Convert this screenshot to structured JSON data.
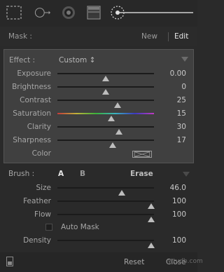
{
  "toolbar": {
    "tools": [
      {
        "name": "crop-overlay-tool",
        "icon": "crop-icon"
      },
      {
        "name": "spot-removal-tool",
        "icon": "spot-circle-arrow-icon"
      },
      {
        "name": "red-eye-tool",
        "icon": "red-eye-icon"
      },
      {
        "name": "graduated-filter-tool",
        "icon": "graduated-filter-icon"
      },
      {
        "name": "adjustment-brush-tool",
        "icon": "adjustment-brush-icon"
      }
    ]
  },
  "mask": {
    "label": "Mask :",
    "new_label": "New",
    "edit_label": "Edit"
  },
  "effect": {
    "label": "Effect :",
    "preset": "Custom ↕",
    "sliders": [
      {
        "label": "Exposure",
        "value": "0.00",
        "position": 0.5
      },
      {
        "label": "Brightness",
        "value": "0",
        "position": 0.5
      },
      {
        "label": "Contrast",
        "value": "25",
        "position": 0.62
      },
      {
        "label": "Saturation",
        "value": "15",
        "position": 0.56
      },
      {
        "label": "Clarity",
        "value": "30",
        "position": 0.64
      },
      {
        "label": "Sharpness",
        "value": "17",
        "position": 0.57
      }
    ],
    "color_label": "Color"
  },
  "brush": {
    "label": "Brush :",
    "a_label": "A",
    "b_label": "B",
    "erase_label": "Erase",
    "sliders": [
      {
        "label": "Size",
        "value": "46.0",
        "position": 0.67
      },
      {
        "label": "Feather",
        "value": "100",
        "position": 0.97
      },
      {
        "label": "Flow",
        "value": "100",
        "position": 0.97
      }
    ],
    "automask_label": "Auto Mask",
    "density": {
      "label": "Density",
      "value": "100",
      "position": 0.97
    }
  },
  "footer": {
    "reset_label": "Reset",
    "close_label": "Close",
    "watermark": "wtvdb.com"
  },
  "colors": {
    "panel_bg": "#2a2a2a",
    "effect_bg": "#404040",
    "track": "#1b1b1b",
    "thumb": "#bdbdbd"
  }
}
